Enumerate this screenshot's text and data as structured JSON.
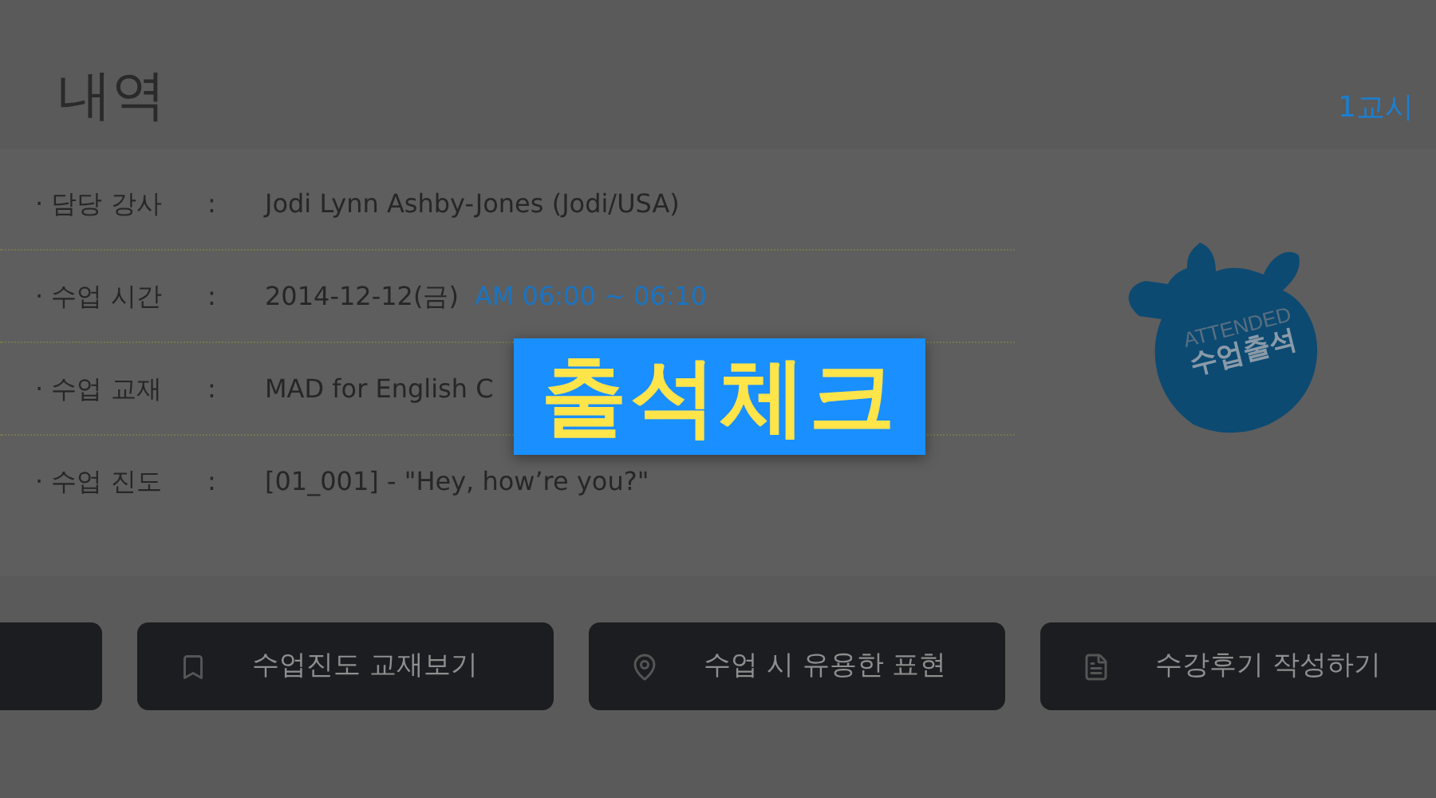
{
  "header": {
    "title": "내역",
    "period": "1교시"
  },
  "details": [
    {
      "label": "· 담당 강사",
      "value": "Jodi Lynn Ashby-Jones (Jodi/USA)"
    },
    {
      "label": "· 수업 시간",
      "value": "2014-12-12(금)",
      "time": "AM 06:00 ~ 06:10"
    },
    {
      "label": "· 수업 교재",
      "value": "MAD for English C"
    },
    {
      "label": "· 수업 진도",
      "value": "[01_001] - \"Hey, how’re you?\""
    }
  ],
  "separator": ":",
  "stamp": {
    "top": "ATTENDED",
    "bottom": "수업출석"
  },
  "buttons": [
    {
      "kind": "book",
      "label": "수업진도 교재보기"
    },
    {
      "kind": "pin",
      "label": "수업 시 유용한 표현"
    },
    {
      "kind": "doc",
      "label": "수강후기 작성하기"
    }
  ],
  "caption": "출석체크"
}
